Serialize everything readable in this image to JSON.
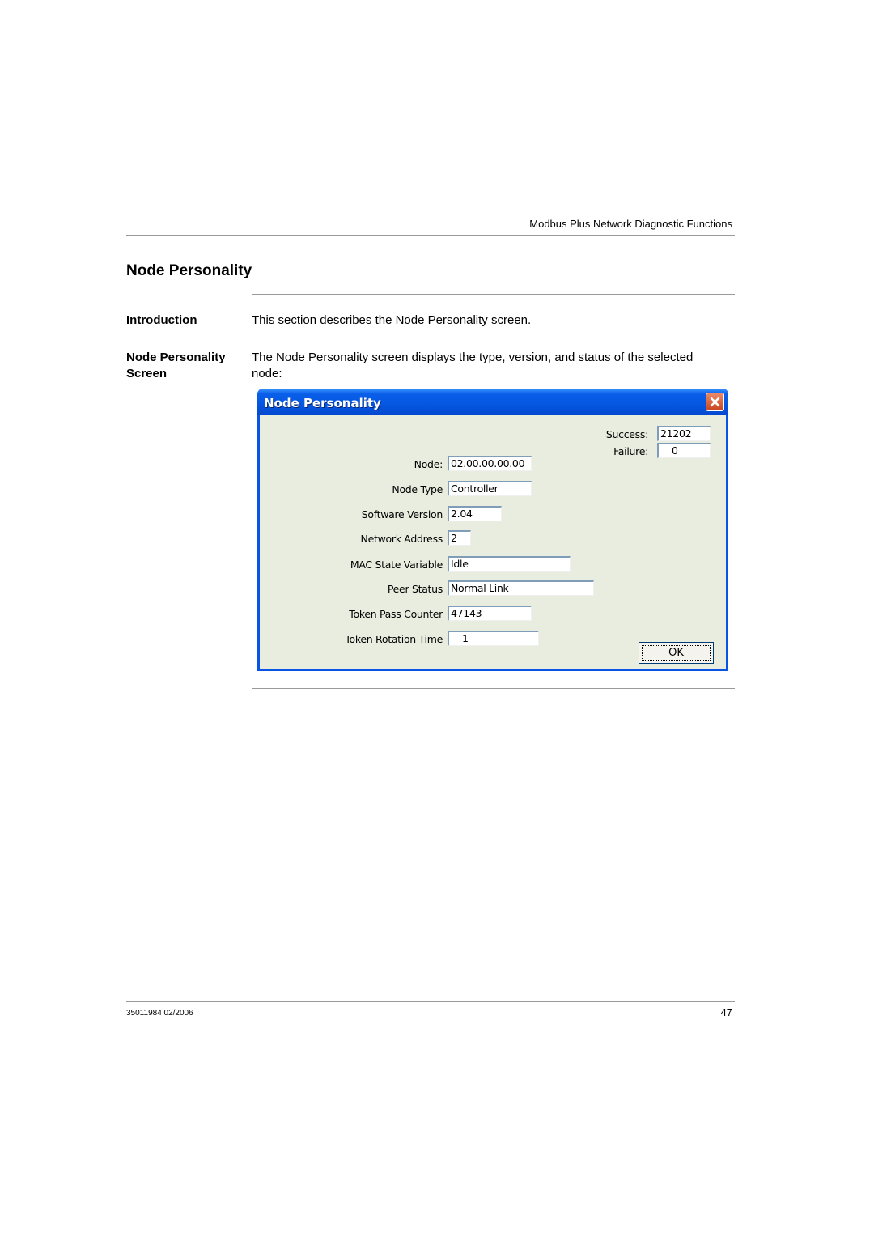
{
  "header": {
    "running_title": "Modbus Plus Network Diagnostic Functions"
  },
  "section": {
    "title": "Node Personality",
    "introduction": {
      "label": "Introduction",
      "text": "This section describes the Node Personality screen."
    },
    "screen": {
      "label_line1": "Node Personality",
      "label_line2": "Screen",
      "text_line1": "The Node Personality screen displays the type, version, and status of the selected",
      "text_line2": "node:"
    }
  },
  "dialog": {
    "title": "Node Personality",
    "close_icon": "close-icon",
    "success_label": "Success:",
    "success_value": "21202",
    "failure_label": "Failure:",
    "failure_value": "0",
    "fields": [
      {
        "label": "Node:",
        "value": "02.00.00.00.00"
      },
      {
        "label": "Node Type",
        "value": "Controller"
      },
      {
        "label": "Software Version",
        "value": "2.04"
      },
      {
        "label": "Network Address",
        "value": "2"
      },
      {
        "label": "MAC State Variable",
        "value": "Idle"
      },
      {
        "label": "Peer Status",
        "value": "Normal Link"
      },
      {
        "label": "Token Pass Counter",
        "value": "47143"
      },
      {
        "label": "Token Rotation Time",
        "value": "1"
      }
    ],
    "ok_label": "OK"
  },
  "footer": {
    "doc_id": "35011984 02/2006",
    "page_number": "47"
  }
}
